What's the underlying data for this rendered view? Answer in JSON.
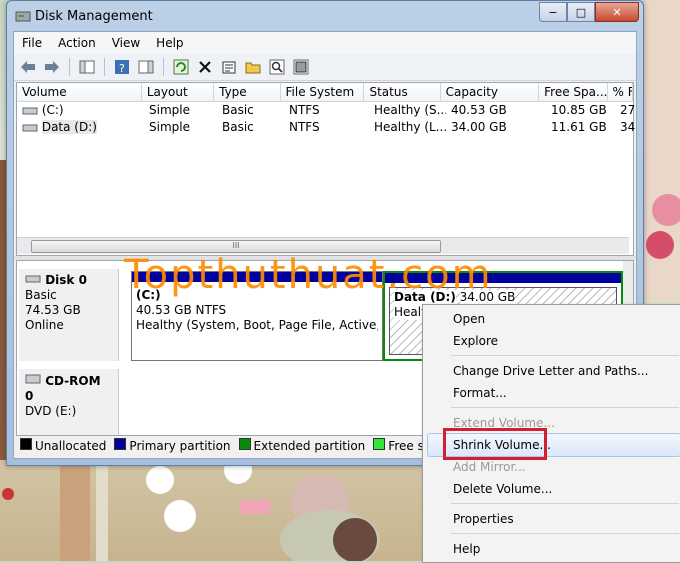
{
  "window": {
    "title": "Disk Management",
    "min": "−",
    "max": "□",
    "close": "✕"
  },
  "menu": [
    "File",
    "Action",
    "View",
    "Help"
  ],
  "columns": [
    "Volume",
    "Layout",
    "Type",
    "File System",
    "Status",
    "Capacity",
    "Free Spa...",
    "% F"
  ],
  "volumes": [
    [
      "(C:)",
      "Simple",
      "Basic",
      "NTFS",
      "Healthy (S...",
      "40.53 GB",
      "10.85 GB",
      "27"
    ],
    [
      "Data (D:)",
      "Simple",
      "Basic",
      "NTFS",
      "Healthy (L...",
      "34.00 GB",
      "11.61 GB",
      "34"
    ]
  ],
  "scrollbar_grip": "III",
  "disks": [
    {
      "name": "Disk 0",
      "type": "Basic",
      "size": "74.53 GB",
      "state": "Online"
    },
    {
      "name": "CD-ROM 0",
      "type": "DVD (E:)"
    }
  ],
  "partitions": [
    {
      "name": "(C:)",
      "size": "40.53 GB NTFS",
      "status": "Healthy (System, Boot, Page File, Active, Cra"
    },
    {
      "name": "Data (D:)",
      "size": "34.00 GB",
      "status": "Healthy"
    }
  ],
  "legend": [
    {
      "label": "Unallocated",
      "color": "#000000"
    },
    {
      "label": "Primary partition",
      "color": "#01019e"
    },
    {
      "label": "Extended partition",
      "color": "#0a8a0a"
    },
    {
      "label": "Free space",
      "color": "#33e633"
    },
    {
      "label": "",
      "color": "#0000ff"
    }
  ],
  "context_menu": {
    "open": "Open",
    "explore": "Explore",
    "change_letter": "Change Drive Letter and Paths...",
    "format": "Format...",
    "extend": "Extend Volume...",
    "shrink": "Shrink Volume...",
    "add_mirror": "Add Mirror...",
    "delete": "Delete Volume...",
    "properties": "Properties",
    "help": "Help"
  },
  "watermark": "Topthuthuat.com",
  "colors": {
    "primary": "#01019e",
    "highlight": "#d3202e",
    "watermark": "#ff8c00"
  }
}
